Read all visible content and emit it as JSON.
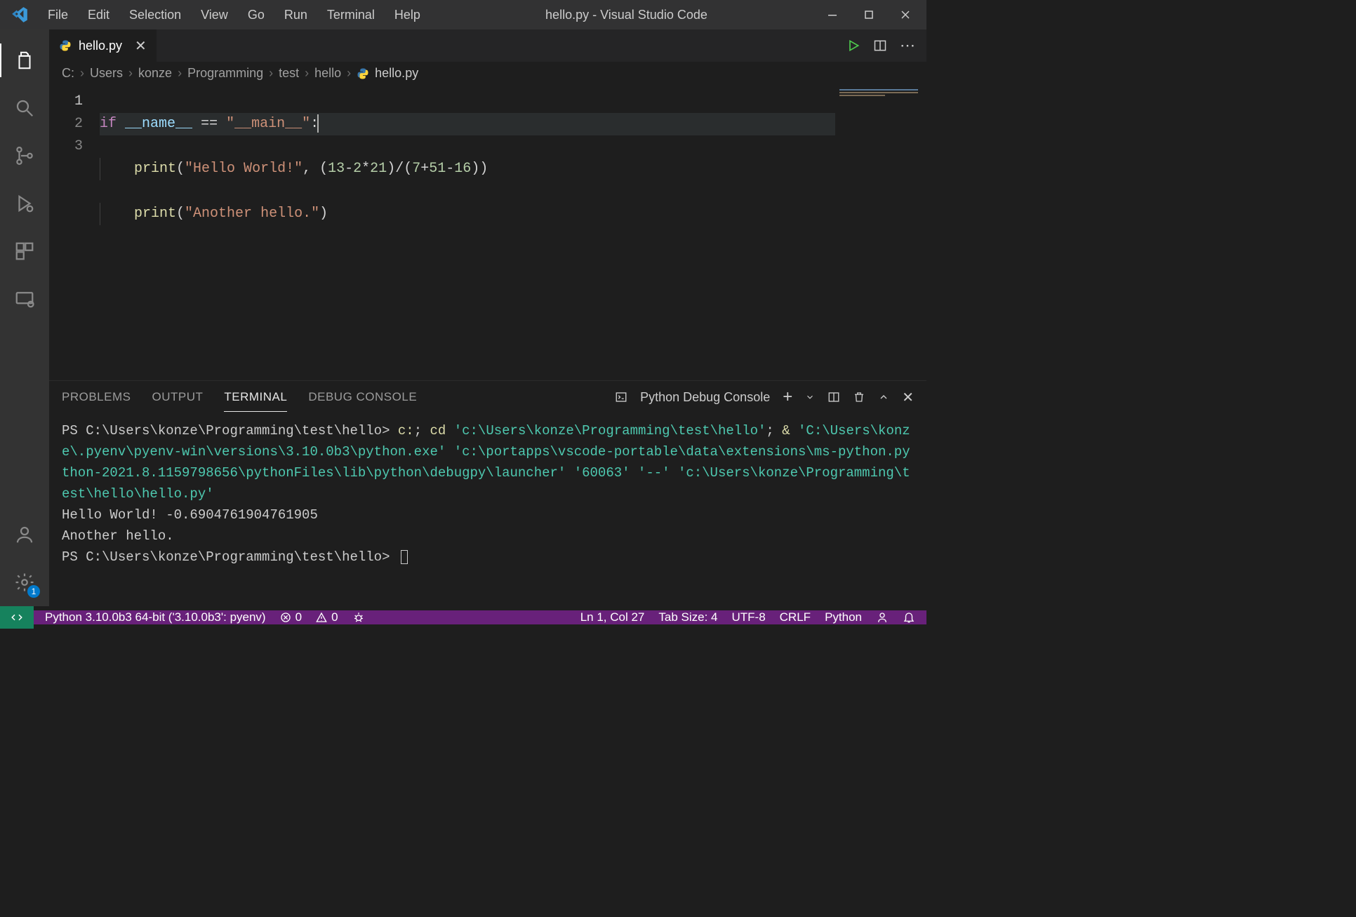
{
  "title": "hello.py - Visual Studio Code",
  "menu": [
    "File",
    "Edit",
    "Selection",
    "View",
    "Go",
    "Run",
    "Terminal",
    "Help"
  ],
  "tab": {
    "name": "hello.py"
  },
  "tab_actions": {},
  "breadcrumb": [
    "C:",
    "Users",
    "konze",
    "Programming",
    "test",
    "hello",
    "hello.py"
  ],
  "gutter": [
    "1",
    "2",
    "3"
  ],
  "code": {
    "l1": {
      "if": "if",
      "name": "__name__",
      "eq": "==",
      "main": "\"__main__\"",
      "colon": ":"
    },
    "l2": {
      "print": "print",
      "open": "(",
      "str": "\"Hello World!\"",
      "comma": ", ",
      "open2": "(",
      "n1": "13",
      "m": "-",
      "n2": "2",
      "t": "*",
      "n3": "21",
      "close2": ")",
      "d": "/",
      "open3": "(",
      "n4": "7",
      "p": "+",
      "n5": "51",
      "m2": "-",
      "n6": "16",
      "close3": ")",
      "close": ")"
    },
    "l3": {
      "print": "print",
      "open": "(",
      "str": "\"Another hello.\"",
      "close": ")"
    }
  },
  "panel_tabs": [
    "PROBLEMS",
    "OUTPUT",
    "TERMINAL",
    "DEBUG CONSOLE"
  ],
  "panel_dropdown": "Python Debug Console",
  "terminal": {
    "line1a": "PS C:\\Users\\konze\\Programming\\test\\hello> ",
    "line1b": "c:",
    "line1c": "; ",
    "line1d": "cd",
    "line1e": " 'c:\\Users\\konze\\Programming\\test\\hello'",
    "line2a": "; ",
    "line2b": "& ",
    "line2c": "'C:\\Users\\konze\\.pyenv\\pyenv-win\\versions\\3.10.0b3\\python.exe' 'c:\\portapps\\vscode-portable\\data\\extensions\\ms-python.python-2021.8.1159798656\\pythonFiles\\lib\\python\\debugpy\\launcher' '60063' '--' 'c:\\Users\\konze\\Programming\\test\\hello\\hello.py'",
    "out1": "Hello World! -0.6904761904761905",
    "out2": "Another hello.",
    "prompt2": "PS C:\\Users\\konze\\Programming\\test\\hello> "
  },
  "status": {
    "python": "Python 3.10.0b3 64-bit ('3.10.0b3': pyenv)",
    "errors": "0",
    "warnings": "0",
    "lncol": "Ln 1, Col 27",
    "tab": "Tab Size: 4",
    "enc": "UTF-8",
    "eol": "CRLF",
    "lang": "Python"
  },
  "settings_badge": "1"
}
